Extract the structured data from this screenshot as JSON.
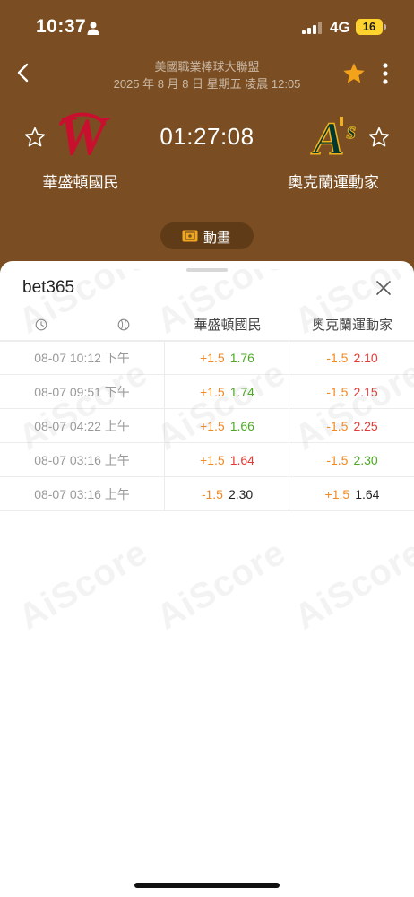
{
  "status_bar": {
    "time": "10:37",
    "network": "4G",
    "battery": "16"
  },
  "header": {
    "league": "美國職業棒球大聯盟",
    "datetime": "2025 年 8 月 8 日 星期五 凌晨 12:05",
    "clock": "01:27:08",
    "home_team": "華盛頓國民",
    "away_team": "奧克蘭運動家",
    "animation_label": "動畫"
  },
  "sheet": {
    "bookmaker": "bet365",
    "columns": {
      "home": "華盛頓國民",
      "away": "奧克蘭運動家"
    },
    "rows": [
      {
        "time": "08-07 10:12 下午",
        "home_hcap": "+1.5",
        "home_odds": "1.76",
        "away_hcap": "-1.5",
        "away_odds": "2.10"
      },
      {
        "time": "08-07 09:51 下午",
        "home_hcap": "+1.5",
        "home_odds": "1.74",
        "away_hcap": "-1.5",
        "away_odds": "2.15"
      },
      {
        "time": "08-07 04:22 上午",
        "home_hcap": "+1.5",
        "home_odds": "1.66",
        "away_hcap": "-1.5",
        "away_odds": "2.25"
      },
      {
        "time": "08-07 03:16 上午",
        "home_hcap": "+1.5",
        "home_odds": "1.64",
        "away_hcap": "-1.5",
        "away_odds": "2.30"
      },
      {
        "time": "08-07 03:16 上午",
        "home_hcap": "-1.5",
        "home_odds": "2.30",
        "away_hcap": "+1.5",
        "away_odds": "1.64"
      }
    ]
  },
  "watermark": "AiScore",
  "colors": {
    "header_bg": "#7a4e22",
    "accent_star": "#f3a21b",
    "odds_up": "#4caa22",
    "odds_down": "#e53935",
    "handicap": "#f08a24"
  },
  "icons": [
    "person-icon",
    "signal-icon",
    "back-icon",
    "star-icon",
    "more-icon",
    "close-icon",
    "clock-icon",
    "baseball-icon",
    "animation-icon"
  ]
}
